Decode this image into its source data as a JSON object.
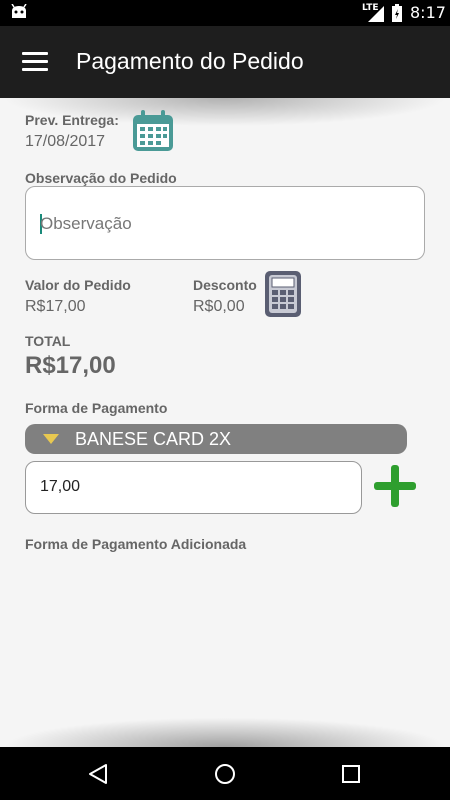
{
  "status_bar": {
    "network": "LTE",
    "time": "8:17"
  },
  "app_bar": {
    "title": "Pagamento do Pedido"
  },
  "delivery": {
    "label": "Prev. Entrega:",
    "date": "17/08/2017"
  },
  "observation": {
    "label": "Observação do Pedido",
    "placeholder": "Observação",
    "value": ""
  },
  "order_value": {
    "label": "Valor do Pedido",
    "value": "R$17,00"
  },
  "discount": {
    "label": "Desconto",
    "value": "R$0,00"
  },
  "total": {
    "label": "TOTAL",
    "value": "R$17,00"
  },
  "payment": {
    "label": "Forma de Pagamento",
    "selected_method": "BANESE CARD 2X",
    "amount": "17,00",
    "added_label": "Forma de Pagamento Adicionada"
  },
  "colors": {
    "app_bar": "#1e1e1e",
    "accent_green": "#2e9e2e",
    "calendar_teal": "#4a9a96",
    "spinner_bg": "#808080",
    "spinner_arrow": "#e8c850"
  }
}
